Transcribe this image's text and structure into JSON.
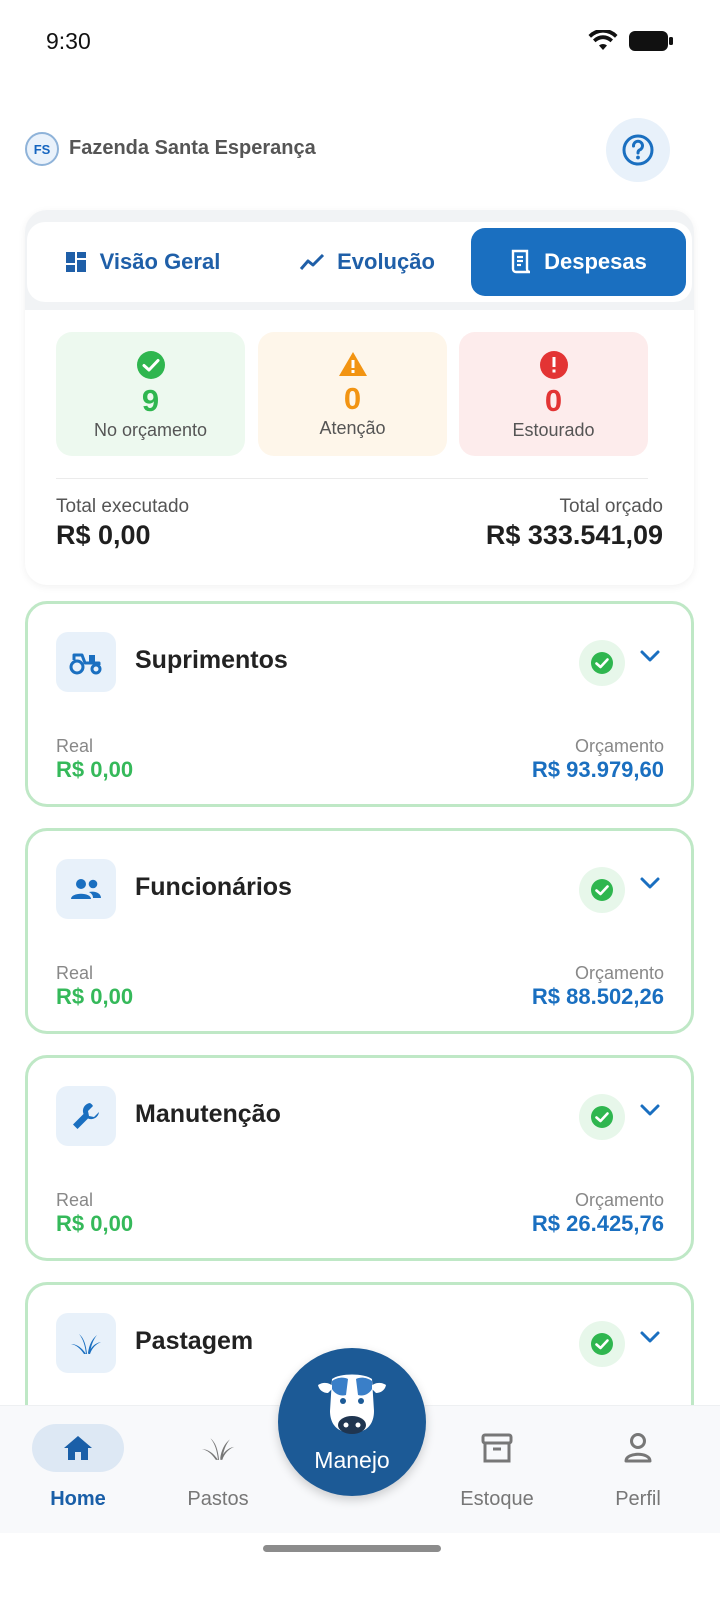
{
  "status_bar": {
    "time": "9:30"
  },
  "header": {
    "farm_initials": "FS",
    "farm_name": "Fazenda Santa Esperança"
  },
  "tabs": [
    {
      "label": "Visão Geral",
      "icon": "dashboard-icon",
      "active": false
    },
    {
      "label": "Evolução",
      "icon": "trend-icon",
      "active": false
    },
    {
      "label": "Despesas",
      "icon": "receipt-icon",
      "active": true
    }
  ],
  "summary": {
    "in_budget": {
      "count": "9",
      "label": "No orçamento"
    },
    "attention": {
      "count": "0",
      "label": "Atenção"
    },
    "over": {
      "count": "0",
      "label": "Estourado"
    },
    "executed_label": "Total executado",
    "executed_value": "R$ 0,00",
    "budgeted_label": "Total orçado",
    "budgeted_value": "R$ 333.541,09"
  },
  "categories": [
    {
      "name": "Suprimentos",
      "icon": "tractor-icon",
      "real_label": "Real",
      "real": "R$ 0,00",
      "budget_label": "Orçamento",
      "budget": "R$ 93.979,60"
    },
    {
      "name": "Funcionários",
      "icon": "people-icon",
      "real_label": "Real",
      "real": "R$ 0,00",
      "budget_label": "Orçamento",
      "budget": "R$ 88.502,26"
    },
    {
      "name": "Manutenção",
      "icon": "wrench-icon",
      "real_label": "Real",
      "real": "R$ 0,00",
      "budget_label": "Orçamento",
      "budget": "R$ 26.425,76"
    },
    {
      "name": "Pastagem",
      "icon": "grass-icon"
    }
  ],
  "bottom_nav": {
    "home": "Home",
    "pastos": "Pastos",
    "manejo": "Manejo",
    "estoque": "Estoque",
    "perfil": "Perfil"
  },
  "colors": {
    "primary": "#1a6fc0",
    "ok": "#2fb64f",
    "warn": "#f29412",
    "over": "#e33434"
  }
}
